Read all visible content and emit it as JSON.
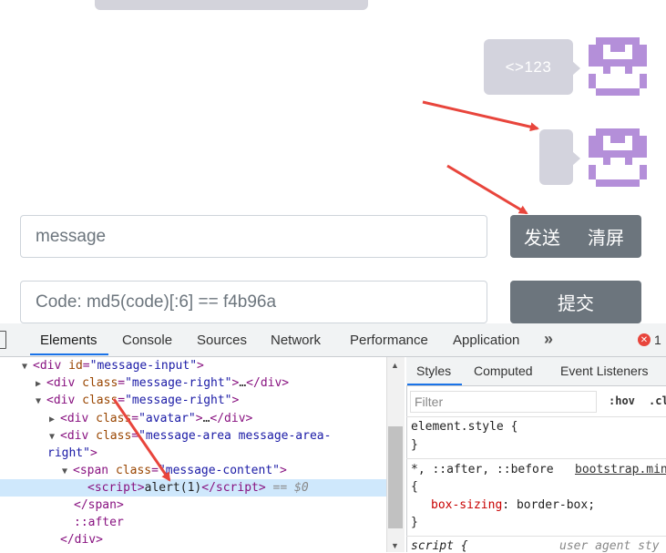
{
  "chat": {
    "message1": "<>123",
    "message2": ""
  },
  "inputs": {
    "message_placeholder": "message",
    "code_placeholder": "Code: md5(code)[:6] == f4b96a"
  },
  "buttons": {
    "send": "发送",
    "clear": "清屏",
    "submit": "提交"
  },
  "devtools": {
    "tabs": [
      "Elements",
      "Console",
      "Sources",
      "Network",
      "Performance",
      "Application"
    ],
    "more": "»",
    "error_count": "1",
    "dom_lines": {
      "l1_attr": "id",
      "l1_val": "\"message-input\"",
      "l2_val": "\"message-right\"",
      "l3_val": "\"message-right\"",
      "l4_val": "\"avatar\"",
      "l5_val_a": "\"message-area message-area-",
      "l5_val_b": "right\"",
      "l6_val": "\"message-content\"",
      "l7_text": "alert(1)",
      "l7_dollar": "== $0",
      "l9": "::after"
    },
    "styles": {
      "tabs": [
        "Styles",
        "Computed",
        "Event Listeners"
      ],
      "filter_placeholder": "Filter",
      "hov": ":hov",
      "cls": ".cl",
      "element_style": "element.style {",
      "close_brace": "}",
      "universal_selector": "*, ::after, ::before",
      "source": "bootstrap.min",
      "open_brace": "{",
      "prop_name": "box-sizing",
      "prop_value": "border-box;",
      "script_selector": "script {",
      "user_agent": "user agent sty"
    }
  },
  "colors": {
    "bubble": "#d3d3dd",
    "avatar": "#b48fd9",
    "button": "#6c757d",
    "arrow": "#e8453c",
    "selected": "#cfe8fc"
  }
}
